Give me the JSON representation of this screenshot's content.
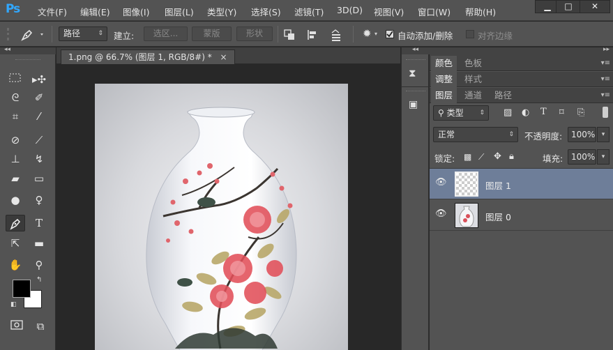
{
  "app": {
    "logo": "Ps",
    "menu": [
      "文件(F)",
      "编辑(E)",
      "图像(I)",
      "图层(L)",
      "类型(Y)",
      "选择(S)",
      "滤镜(T)",
      "3D(D)",
      "视图(V)",
      "窗口(W)",
      "帮助(H)"
    ],
    "window_buttons": {
      "minimize": "▁",
      "maximize": "□",
      "close": "✕"
    }
  },
  "options": {
    "tool_icon": "pen-icon",
    "mode_value": "路径",
    "build_label": "建立:",
    "selection_btn": "选区...",
    "mask_btn": "蒙版",
    "shape_btn": "形状",
    "auto_add_delete": "自动添加/删除",
    "auto_add_delete_checked": true,
    "align_edges": "对齐边缘",
    "align_edges_checked": false
  },
  "toolbox": {
    "collapse": "◂◂",
    "tools": [
      "marquee-icon",
      "move-icon",
      "lasso-icon",
      "quick-select-icon",
      "crop-icon",
      "eyedropper-icon",
      "healing-icon",
      "brush-icon",
      "stamp-icon",
      "history-brush-icon",
      "eraser-icon",
      "gradient-icon",
      "blur-icon",
      "dodge-icon",
      "pen-icon",
      "type-icon",
      "path-select-icon",
      "rectangle-icon",
      "hand-icon",
      "zoom-icon",
      "quick-mask-icon",
      "screen-mode-icon"
    ],
    "foreground_color": "#000000",
    "background_color": "#ffffff"
  },
  "document": {
    "tab_title": "1.png @ 66.7% (图层 1, RGB/8#) *",
    "close": "×"
  },
  "panels": {
    "group1_tabs": [
      "颜色",
      "色板"
    ],
    "group2_tabs": [
      "调整",
      "样式"
    ],
    "group3_tabs": [
      "图层",
      "通道",
      "路径"
    ],
    "filter_kind": "类型",
    "blend_mode": "正常",
    "opacity_label": "不透明度:",
    "opacity_value": "100%",
    "lock_label": "锁定:",
    "fill_label": "填充:",
    "fill_value": "100%",
    "layers": [
      {
        "name": "图层 1",
        "selected": true
      },
      {
        "name": "图层 0",
        "selected": false
      }
    ]
  },
  "colors": {
    "accent_logo": "#31a8ff",
    "selected_layer": "#6e7e99"
  }
}
